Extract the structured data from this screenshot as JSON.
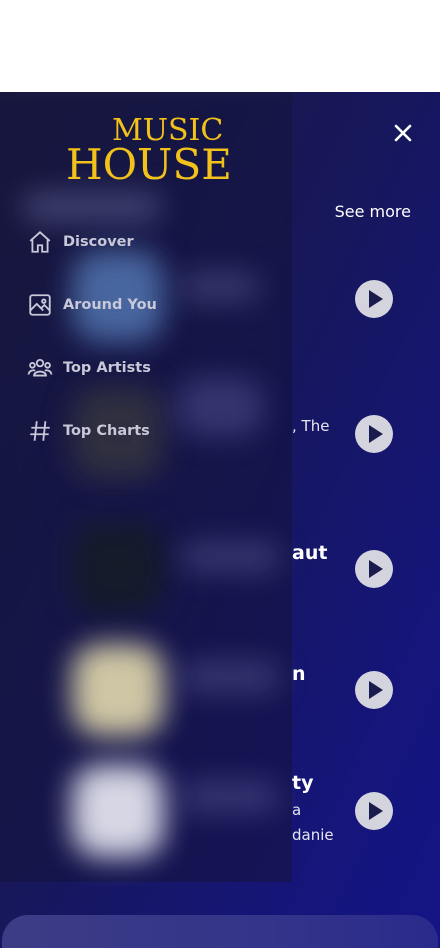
{
  "app": {
    "logo_line1": "MUSIC",
    "logo_line2": "HOUSE"
  },
  "header": {
    "see_more": "See more"
  },
  "drawer": {
    "items": [
      {
        "label": "Discover",
        "icon": "home-icon"
      },
      {
        "label": "Around You",
        "icon": "image-icon"
      },
      {
        "label": "Top Artists",
        "icon": "users-icon"
      },
      {
        "label": "Top Charts",
        "icon": "hash-icon"
      }
    ]
  },
  "songs": [
    {
      "peek": ""
    },
    {
      "peek": ", The"
    },
    {
      "peek": "aut"
    },
    {
      "peek": "n"
    },
    {
      "peek": "ty",
      "peek2": "a",
      "peek3": "danie"
    }
  ],
  "colors": {
    "accent": "#f2c21b",
    "background": "#15157a",
    "play_button": "#d4d4de"
  }
}
